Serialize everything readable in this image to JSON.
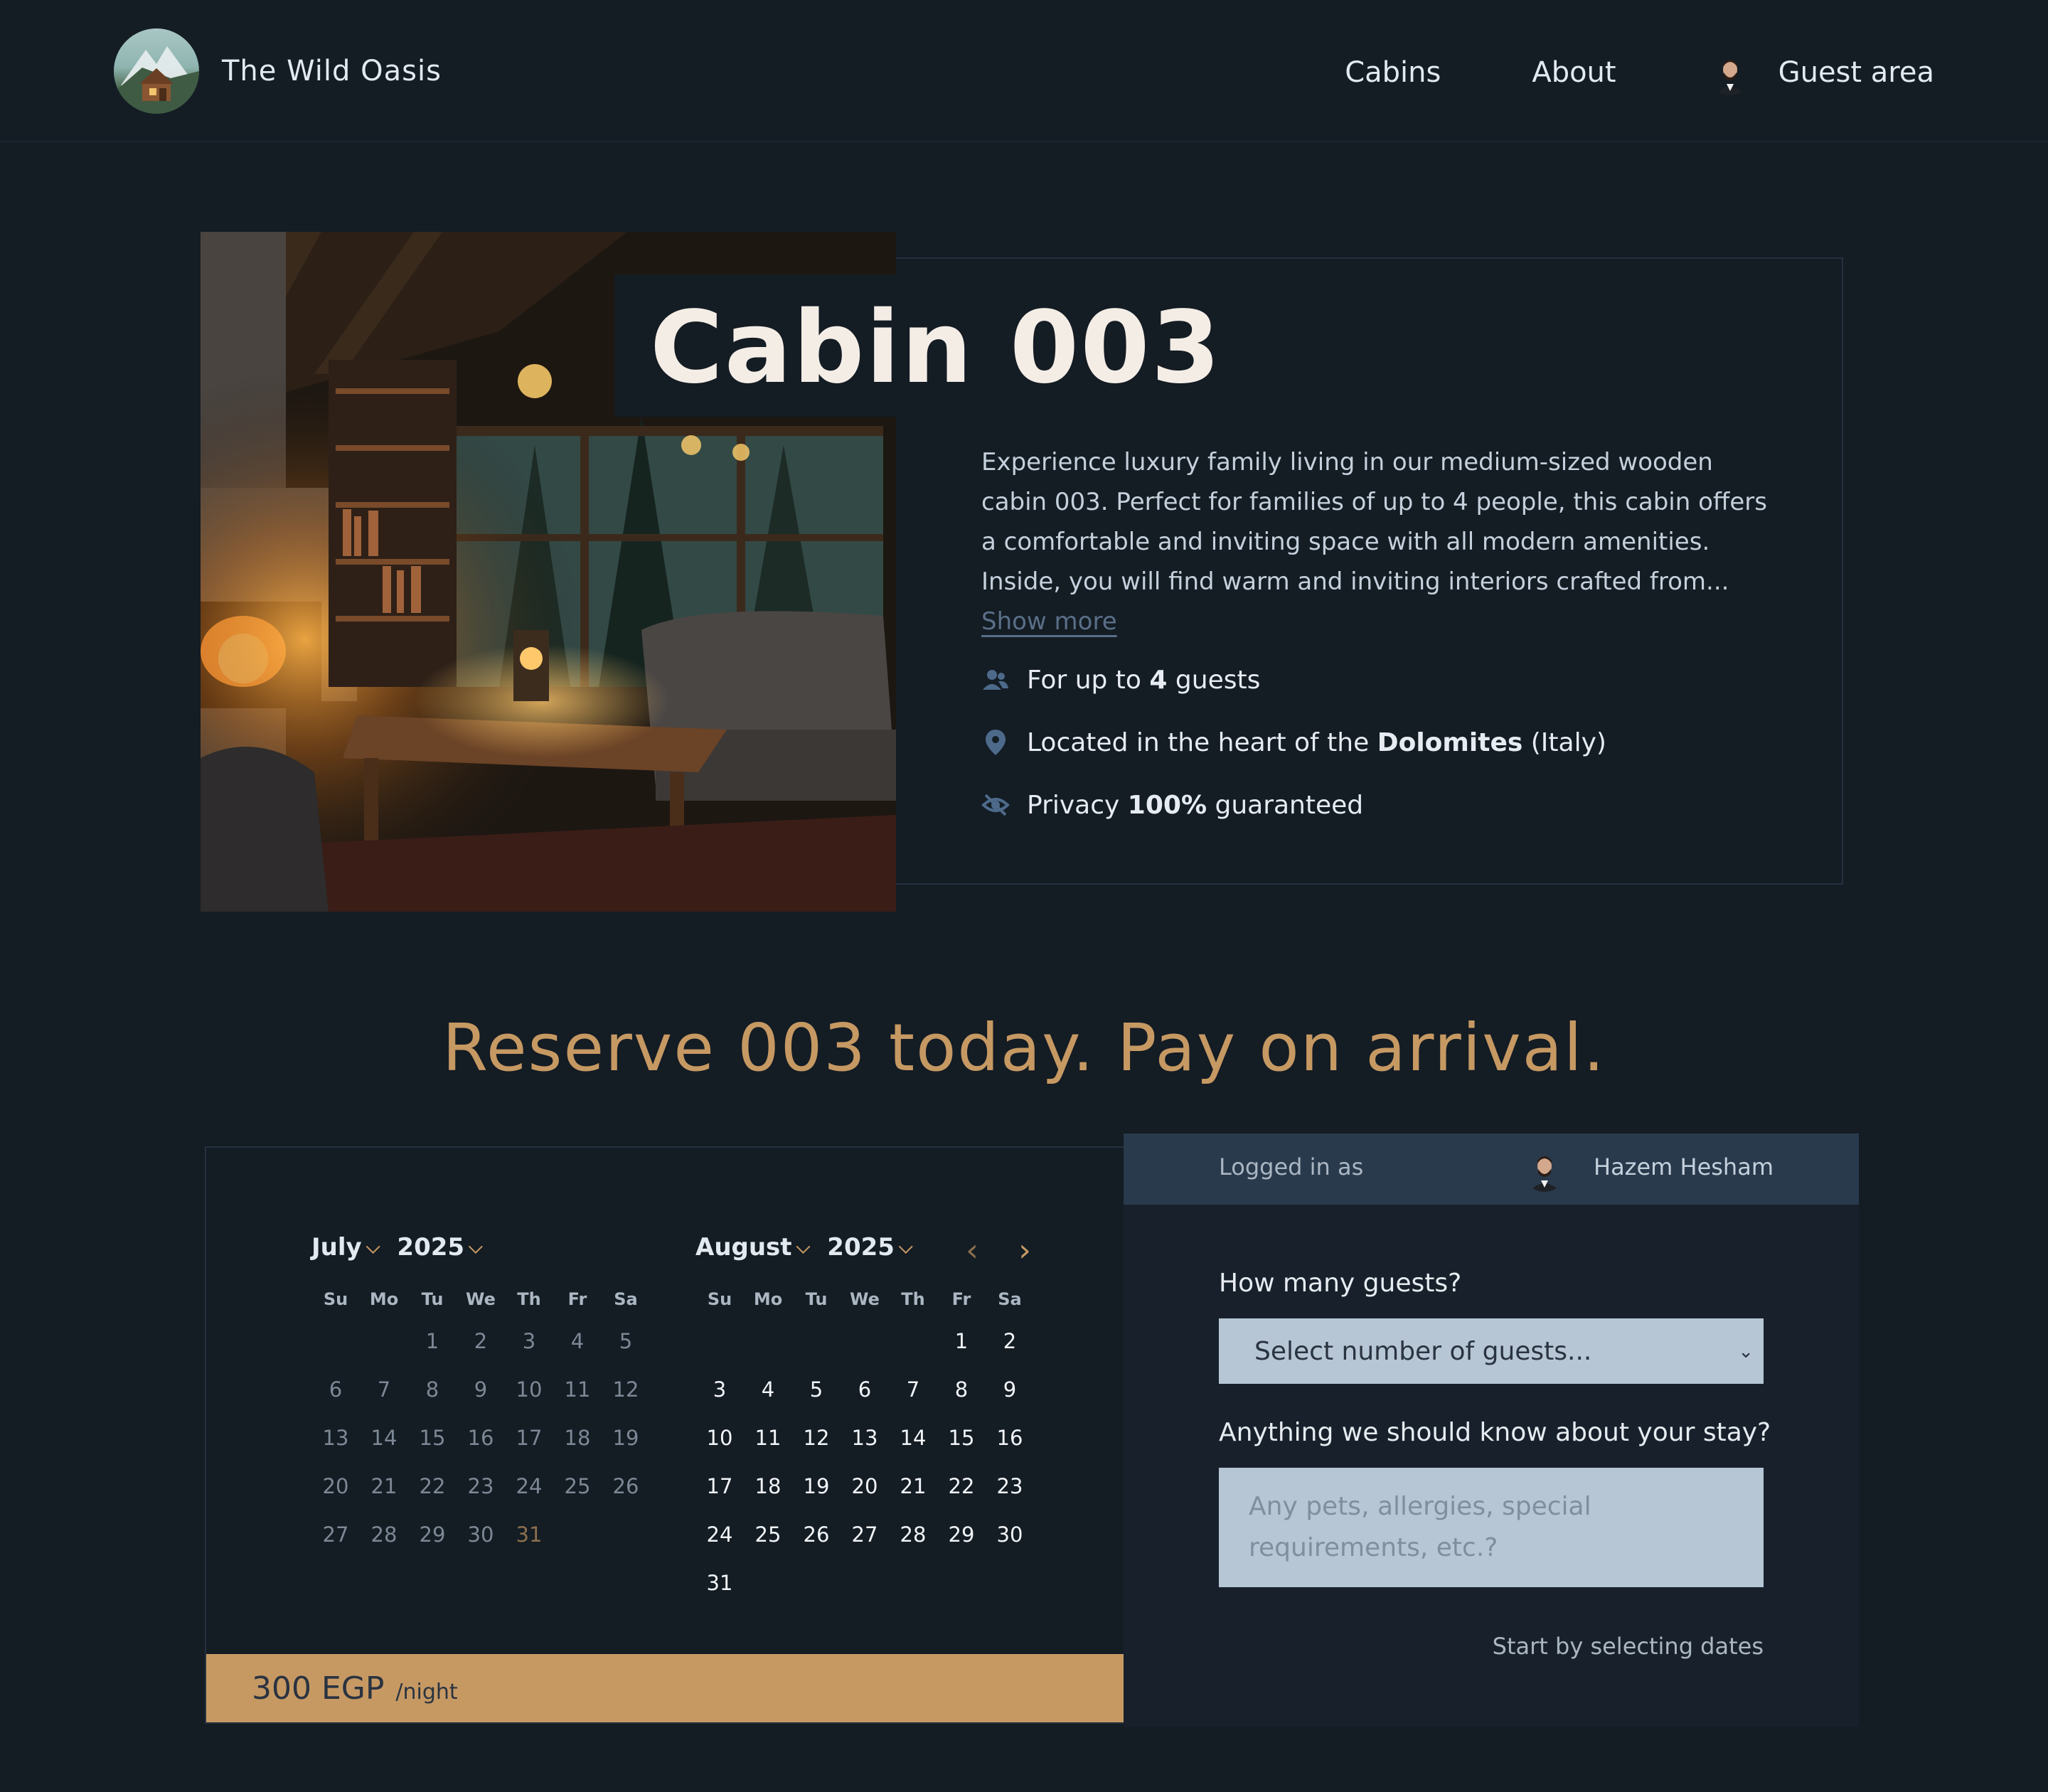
{
  "brand": {
    "name": "The Wild Oasis"
  },
  "nav": {
    "cabins": "Cabins",
    "about": "About",
    "guest_area": "Guest area"
  },
  "cabin": {
    "title": "Cabin 003",
    "description": "Experience luxury family living in our medium-sized wooden cabin 003. Perfect for families of up to 4 people, this cabin offers a comfortable and inviting space with all modern amenities. Inside, you will find warm and inviting interiors crafted from...",
    "show_more": "Show more",
    "features": {
      "guests_pre": "For up to",
      "guests_num": "4",
      "guests_post": "guests",
      "location_pre": "Located in the heart of the",
      "location_bold": "Dolomites",
      "location_post": "(Italy)",
      "privacy_pre": "Privacy",
      "privacy_bold": "100%",
      "privacy_post": "guaranteed"
    }
  },
  "reserve": {
    "title": "Reserve 003 today. Pay on arrival."
  },
  "calendar": {
    "weekdays": [
      "Su",
      "Mo",
      "Tu",
      "We",
      "Th",
      "Fr",
      "Sa"
    ],
    "left": {
      "month": "July",
      "year": "2025",
      "weeks": [
        [
          "",
          "",
          "1",
          "2",
          "3",
          "4",
          "5"
        ],
        [
          "6",
          "7",
          "8",
          "9",
          "10",
          "11",
          "12"
        ],
        [
          "13",
          "14",
          "15",
          "16",
          "17",
          "18",
          "19"
        ],
        [
          "20",
          "21",
          "22",
          "23",
          "24",
          "25",
          "26"
        ],
        [
          "27",
          "28",
          "29",
          "30",
          "31",
          "",
          ""
        ]
      ],
      "highlight_day": "31"
    },
    "right": {
      "month": "August",
      "year": "2025",
      "weeks": [
        [
          "",
          "",
          "",
          "",
          "",
          "1",
          "2"
        ],
        [
          "3",
          "4",
          "5",
          "6",
          "7",
          "8",
          "9"
        ],
        [
          "10",
          "11",
          "12",
          "13",
          "14",
          "15",
          "16"
        ],
        [
          "17",
          "18",
          "19",
          "20",
          "21",
          "22",
          "23"
        ],
        [
          "24",
          "25",
          "26",
          "27",
          "28",
          "29",
          "30"
        ],
        [
          "31",
          "",
          "",
          "",
          "",
          "",
          ""
        ]
      ]
    },
    "prev_icon": "chevron-left-icon",
    "next_icon": "chevron-right-icon"
  },
  "price": {
    "value": "300 EGP",
    "unit": "/night"
  },
  "form": {
    "logged_in_label": "Logged in as",
    "user_name": "Hazem Hesham",
    "guests_label": "How many guests?",
    "guests_select_value": "Select number of guests...",
    "notes_label": "Anything we should know about your stay?",
    "notes_placeholder": "Any pets, allergies, special requirements, etc.?",
    "start_hint": "Start by selecting dates"
  },
  "colors": {
    "background": "#141c24",
    "accent": "#c69963",
    "panel": "#18212b",
    "login_bar": "#2a3a4d",
    "input_bg": "#b7c6d5"
  }
}
